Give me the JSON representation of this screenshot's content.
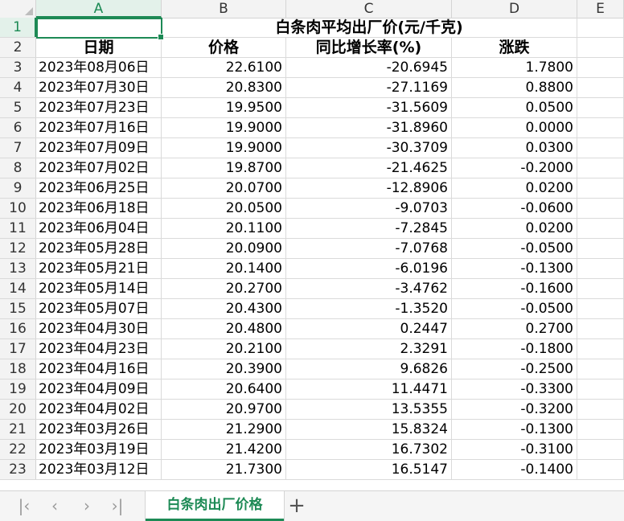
{
  "columns": [
    "A",
    "B",
    "C",
    "D",
    "E"
  ],
  "title": "白条肉平均出厂价(元/千克)",
  "headers": {
    "date": "日期",
    "price": "价格",
    "yoy": "同比增长率(%)",
    "change": "涨跌"
  },
  "row_numbers": [
    "1",
    "2",
    "3",
    "4",
    "5",
    "6",
    "7",
    "8",
    "9",
    "10",
    "11",
    "12",
    "13",
    "14",
    "15",
    "16",
    "17",
    "18",
    "19",
    "20",
    "21",
    "22",
    "23"
  ],
  "rows": [
    {
      "date": "2023年08月06日",
      "price": "22.6100",
      "yoy": "-20.6945",
      "change": "1.7800"
    },
    {
      "date": "2023年07月30日",
      "price": "20.8300",
      "yoy": "-27.1169",
      "change": "0.8800"
    },
    {
      "date": "2023年07月23日",
      "price": "19.9500",
      "yoy": "-31.5609",
      "change": "0.0500"
    },
    {
      "date": "2023年07月16日",
      "price": "19.9000",
      "yoy": "-31.8960",
      "change": "0.0000"
    },
    {
      "date": "2023年07月09日",
      "price": "19.9000",
      "yoy": "-30.3709",
      "change": "0.0300"
    },
    {
      "date": "2023年07月02日",
      "price": "19.8700",
      "yoy": "-21.4625",
      "change": "-0.2000"
    },
    {
      "date": "2023年06月25日",
      "price": "20.0700",
      "yoy": "-12.8906",
      "change": "0.0200"
    },
    {
      "date": "2023年06月18日",
      "price": "20.0500",
      "yoy": "-9.0703",
      "change": "-0.0600"
    },
    {
      "date": "2023年06月04日",
      "price": "20.1100",
      "yoy": "-7.2845",
      "change": "0.0200"
    },
    {
      "date": "2023年05月28日",
      "price": "20.0900",
      "yoy": "-7.0768",
      "change": "-0.0500"
    },
    {
      "date": "2023年05月21日",
      "price": "20.1400",
      "yoy": "-6.0196",
      "change": "-0.1300"
    },
    {
      "date": "2023年05月14日",
      "price": "20.2700",
      "yoy": "-3.4762",
      "change": "-0.1600"
    },
    {
      "date": "2023年05月07日",
      "price": "20.4300",
      "yoy": "-1.3520",
      "change": "-0.0500"
    },
    {
      "date": "2023年04月30日",
      "price": "20.4800",
      "yoy": "0.2447",
      "change": "0.2700"
    },
    {
      "date": "2023年04月23日",
      "price": "20.2100",
      "yoy": "2.3291",
      "change": "-0.1800"
    },
    {
      "date": "2023年04月16日",
      "price": "20.3900",
      "yoy": "9.6826",
      "change": "-0.2500"
    },
    {
      "date": "2023年04月09日",
      "price": "20.6400",
      "yoy": "11.4471",
      "change": "-0.3300"
    },
    {
      "date": "2023年04月02日",
      "price": "20.9700",
      "yoy": "13.5355",
      "change": "-0.3200"
    },
    {
      "date": "2023年03月26日",
      "price": "21.2900",
      "yoy": "15.8324",
      "change": "-0.1300"
    },
    {
      "date": "2023年03月19日",
      "price": "21.4200",
      "yoy": "16.7302",
      "change": "-0.3100"
    },
    {
      "date": "2023年03月12日",
      "price": "21.7300",
      "yoy": "16.5147",
      "change": "-0.1400"
    }
  ],
  "sheet_tab": "白条肉出厂价格",
  "nav_icons": [
    "first-sheet-icon",
    "prev-sheet-icon",
    "next-sheet-icon",
    "last-sheet-icon"
  ],
  "colors": {
    "accent": "#1d8a55",
    "header_bg": "#f3f3f3",
    "gridline": "#dadada"
  }
}
